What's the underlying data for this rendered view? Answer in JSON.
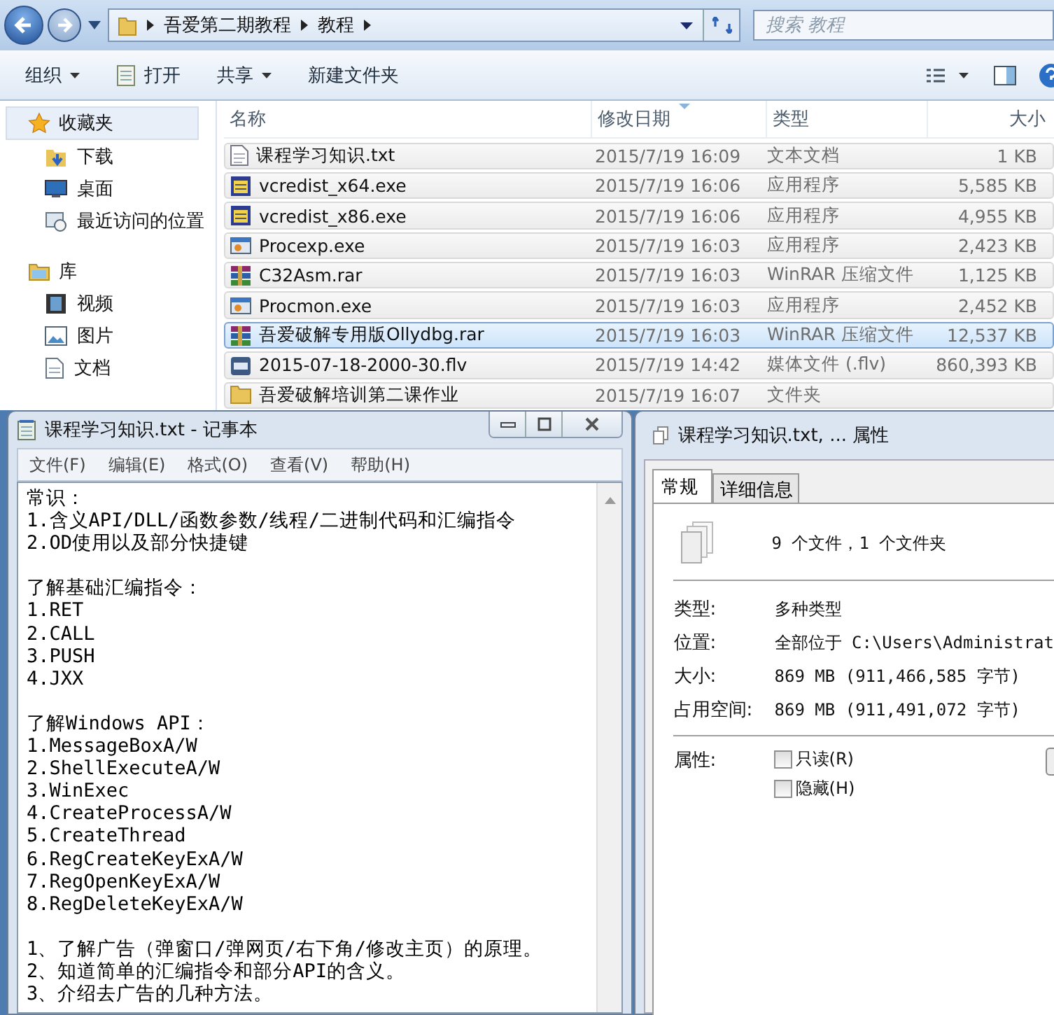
{
  "explorer": {
    "breadcrumb": [
      "吾爱第二期教程",
      "教程"
    ],
    "search": {
      "placeholder": "搜索 教程"
    },
    "toolbar": [
      {
        "label": "组织",
        "kind": "menu"
      },
      {
        "label": "打开",
        "kind": "open"
      },
      {
        "label": "共享",
        "kind": "menu"
      },
      {
        "label": "新建文件夹",
        "kind": "plain"
      }
    ],
    "sidebar": [
      {
        "label": "收藏夹",
        "kind": "favorites",
        "children": [
          {
            "label": "下载",
            "kind": "download"
          },
          {
            "label": "桌面",
            "kind": "desktop"
          },
          {
            "label": "最近访问的位置",
            "kind": "recent"
          }
        ]
      },
      {
        "label": "库",
        "kind": "library",
        "children": [
          {
            "label": "视频",
            "kind": "video"
          },
          {
            "label": "图片",
            "kind": "picture"
          },
          {
            "label": "文档",
            "kind": "document"
          }
        ]
      }
    ],
    "columns": [
      {
        "label": "名称",
        "sorted": false
      },
      {
        "label": "修改日期",
        "sorted": true
      },
      {
        "label": "类型",
        "sorted": false
      },
      {
        "label": "大小",
        "sorted": false
      }
    ],
    "rows": [
      {
        "name": "课程学习知识.txt",
        "date": "2015/7/19 16:09",
        "type": "文本文档",
        "size": "1 KB",
        "kind": "text",
        "selected": true,
        "focused": false
      },
      {
        "name": "vcredist_x64.exe",
        "date": "2015/7/19 16:06",
        "type": "应用程序",
        "size": "5,585 KB",
        "kind": "installer",
        "selected": true,
        "focused": false
      },
      {
        "name": "vcredist_x86.exe",
        "date": "2015/7/19 16:06",
        "type": "应用程序",
        "size": "4,955 KB",
        "kind": "installer",
        "selected": true,
        "focused": false
      },
      {
        "name": "Procexp.exe",
        "date": "2015/7/19 16:03",
        "type": "应用程序",
        "size": "2,423 KB",
        "kind": "app",
        "selected": true,
        "focused": false
      },
      {
        "name": "C32Asm.rar",
        "date": "2015/7/19 16:03",
        "type": "WinRAR 压缩文件",
        "size": "1,125 KB",
        "kind": "archive",
        "selected": true,
        "focused": false
      },
      {
        "name": "Procmon.exe",
        "date": "2015/7/19 16:03",
        "type": "应用程序",
        "size": "2,452 KB",
        "kind": "app",
        "selected": true,
        "focused": false
      },
      {
        "name": "吾爱破解专用版Ollydbg.rar",
        "date": "2015/7/19 16:03",
        "type": "WinRAR 压缩文件",
        "size": "12,537 KB",
        "kind": "archive",
        "selected": true,
        "focused": true
      },
      {
        "name": "2015-07-18-2000-30.flv",
        "date": "2015/7/19 14:42",
        "type": "媒体文件 (.flv)",
        "size": "860,393 KB",
        "kind": "video",
        "selected": true,
        "focused": false
      },
      {
        "name": "吾爱破解培训第二课作业",
        "date": "2015/7/19 16:07",
        "type": "文件夹",
        "kind": "folder",
        "selected": true,
        "focused": false
      }
    ]
  },
  "notepad": {
    "title": "课程学习知识.txt - 记事本",
    "menu": [
      "文件(F)",
      "编辑(E)",
      "格式(O)",
      "查看(V)",
      "帮助(H)"
    ],
    "paragraphs": [
      [
        "常识：",
        "1.含义API/DLL/函数参数/线程/二进制代码和汇编指令",
        "2.OD使用以及部分快捷键"
      ],
      [
        "了解基础汇编指令：",
        "1.RET",
        "2.CALL",
        "3.PUSH",
        "4.JXX"
      ],
      [
        "了解Windows API：",
        "1.MessageBoxA/W",
        "2.ShellExecuteA/W",
        "3.WinExec",
        "4.CreateProcessA/W",
        "5.CreateThread",
        "6.RegCreateKeyExA/W",
        "7.RegOpenKeyExA/W",
        "8.RegDeleteKeyExA/W"
      ],
      [
        "1、了解广告（弹窗口/弹网页/右下角/修改主页）的原理。",
        "2、知道简单的汇编指令和部分API的含义。",
        "3、介绍去广告的几种方法。"
      ]
    ]
  },
  "properties": {
    "title": "课程学习知识.txt, ... 属性",
    "tabs": [
      {
        "label": "常规",
        "selected": true
      },
      {
        "label": "详细信息",
        "selected": false
      }
    ],
    "summary": "9 个文件，1 个文件夹",
    "fields": [
      {
        "label": "类型:",
        "value": "多种类型"
      },
      {
        "label": "位置:",
        "value": "全部位于 C:\\Users\\Administrat"
      },
      {
        "label": "大小:",
        "value": "869 MB (911,466,585 字节)"
      },
      {
        "label": "占用空间:",
        "value": "869 MB (911,491,072 字节)"
      }
    ],
    "attributes_label": "属性:",
    "attributes": [
      {
        "label": "只读(R)",
        "checked": false
      },
      {
        "label": "隐藏(H)",
        "checked": false
      }
    ]
  }
}
